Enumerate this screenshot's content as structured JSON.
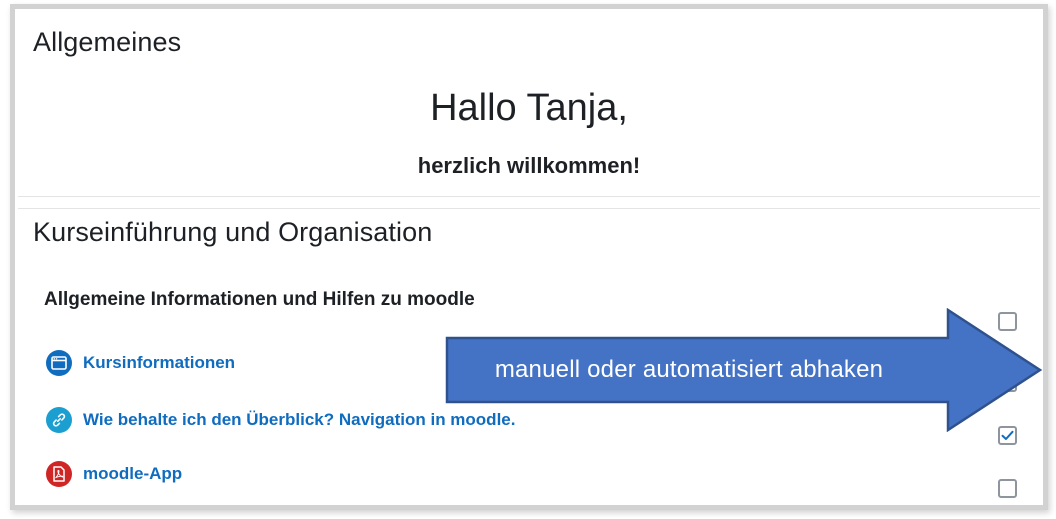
{
  "sections": [
    {
      "title": "Allgemeines"
    },
    {
      "title": "Kurseinführung und Organisation"
    }
  ],
  "welcome": {
    "greeting": "Hallo Tanja,",
    "message": "herzlich willkommen!"
  },
  "subheading": "Allgemeine Informationen und Hilfen zu moodle",
  "activities": [
    {
      "label": "Kursinformationen",
      "icon": "page-icon",
      "completed": false
    },
    {
      "label": "Wie behalte ich den Überblick? Navigation in moodle.",
      "icon": "url-link-icon",
      "completed": true
    },
    {
      "label": "moodle-App",
      "icon": "pdf-icon",
      "completed": false
    }
  ],
  "callout": {
    "text": "manuell oder automatisiert abhaken",
    "color": "#4472c4",
    "border_color": "#2f528f"
  },
  "colors": {
    "link": "#0f6cbf",
    "page_icon_bg": "#0f6cbf",
    "url_icon_bg": "#1a9fd0",
    "pdf_icon_bg": "#d02525",
    "check": "#0f6cbf"
  }
}
